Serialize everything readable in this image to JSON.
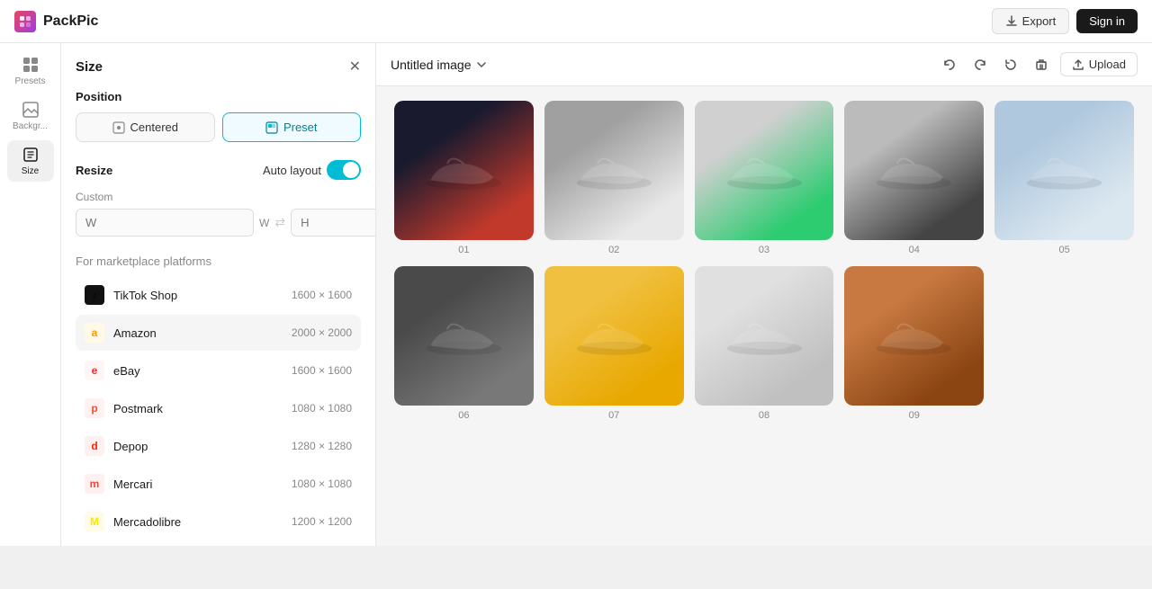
{
  "navbar": {
    "logo_text": "PackPic",
    "export_label": "Export",
    "signin_label": "Sign in"
  },
  "icon_sidebar": {
    "items": [
      {
        "id": "presets",
        "label": "Presets",
        "icon": "grid"
      },
      {
        "id": "background",
        "label": "Backgr...",
        "icon": "image"
      },
      {
        "id": "size",
        "label": "Size",
        "icon": "resize",
        "active": true
      }
    ]
  },
  "left_panel": {
    "title": "Size",
    "position": {
      "label": "Position",
      "centered_label": "Centered",
      "preset_label": "Preset",
      "active": "preset"
    },
    "resize": {
      "label": "Resize",
      "auto_layout_label": "Auto layout",
      "toggle_on": true,
      "custom_label": "Custom",
      "width_placeholder": "W",
      "height_placeholder": "H"
    },
    "marketplace": {
      "section_label": "For marketplace platforms",
      "items": [
        {
          "id": "tiktok",
          "name": "TikTok Shop",
          "size": "1600 × 1600",
          "color": "#000",
          "icon": "♪"
        },
        {
          "id": "amazon",
          "name": "Amazon",
          "size": "2000 × 2000",
          "color": "#ff9900",
          "icon": "a",
          "active": true
        },
        {
          "id": "ebay",
          "name": "eBay",
          "size": "1600 × 1600",
          "color": "#e53238",
          "icon": "e"
        },
        {
          "id": "postmark",
          "name": "Postmark",
          "size": "1080 × 1080",
          "color": "#f05033",
          "icon": "p"
        },
        {
          "id": "depop",
          "name": "Depop",
          "size": "1280 × 1280",
          "color": "#ff2300",
          "icon": "d"
        },
        {
          "id": "mercari",
          "name": "Mercari",
          "size": "1080 × 1080",
          "color": "#e74c3c",
          "icon": "m"
        },
        {
          "id": "mercadolibre",
          "name": "Mercadolibre",
          "size": "1200 × 1200",
          "color": "#ffe600",
          "icon": "M"
        }
      ]
    }
  },
  "canvas": {
    "title": "Untitled image",
    "upload_label": "Upload",
    "images": [
      {
        "num": "01",
        "class": "shoe-1"
      },
      {
        "num": "02",
        "class": "shoe-2"
      },
      {
        "num": "03",
        "class": "shoe-3"
      },
      {
        "num": "04",
        "class": "shoe-4"
      },
      {
        "num": "05",
        "class": "shoe-5"
      },
      {
        "num": "06",
        "class": "shoe-6"
      },
      {
        "num": "07",
        "class": "shoe-7"
      },
      {
        "num": "08",
        "class": "shoe-8"
      },
      {
        "num": "09",
        "class": "shoe-9"
      }
    ]
  }
}
